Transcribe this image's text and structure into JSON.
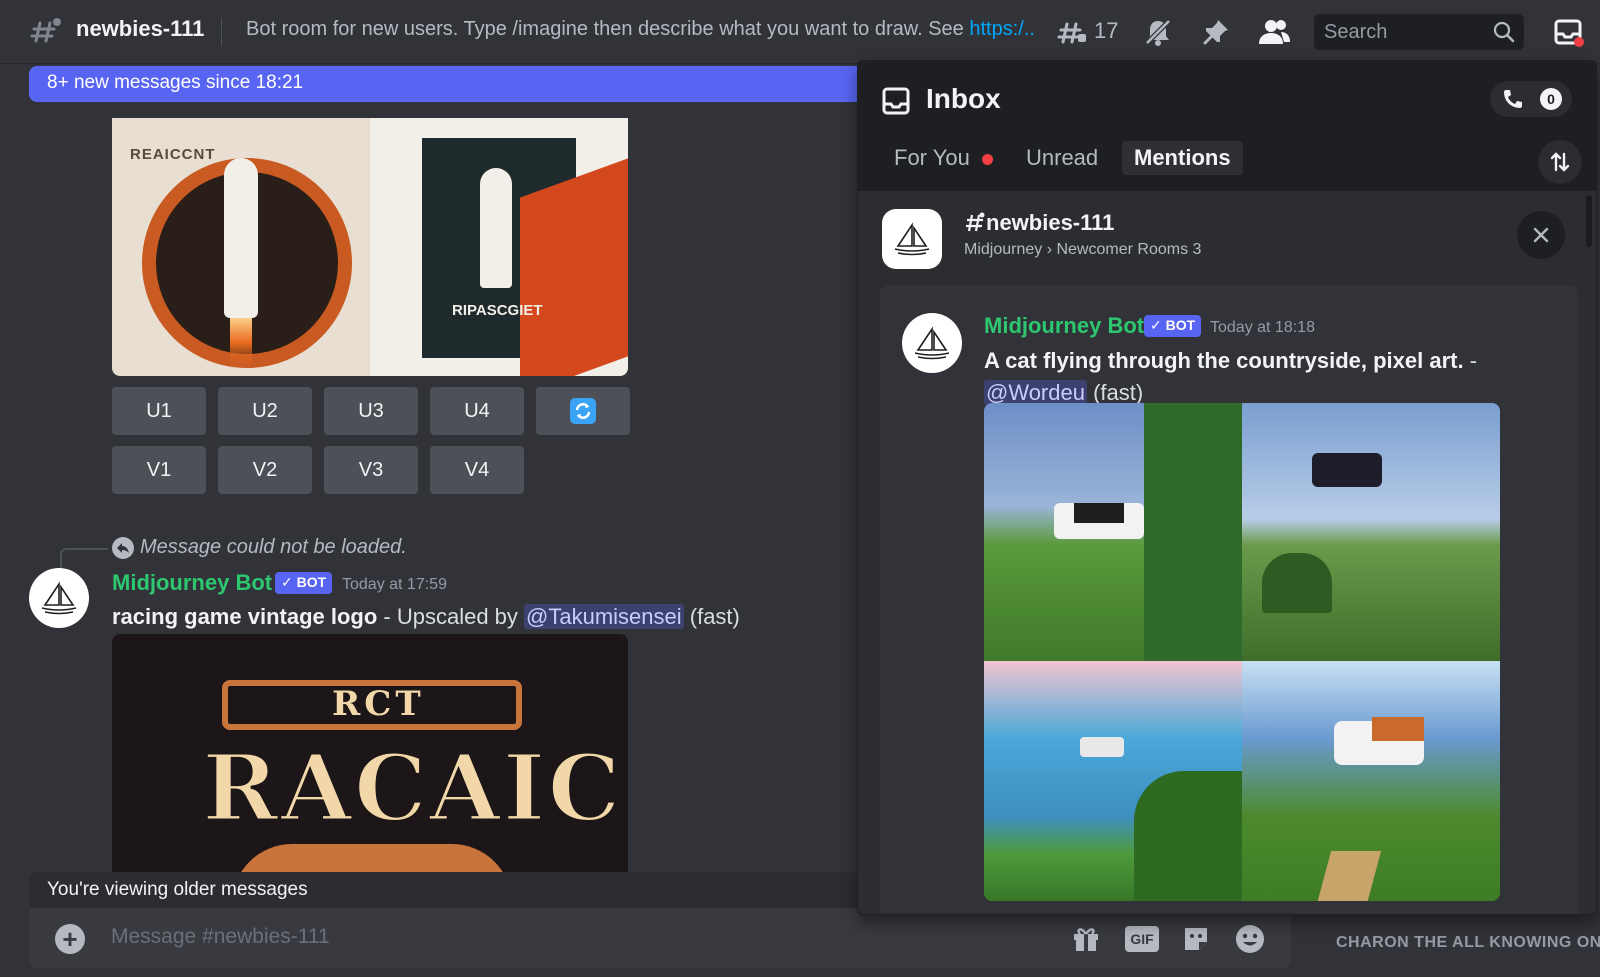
{
  "header": {
    "channel_name": "newbies-111",
    "topic": "Bot room for new users. Type /imagine then describe what you want to draw. See ",
    "topic_link": "https:/...",
    "thread_count": "17",
    "search_placeholder": "Search"
  },
  "chat": {
    "new_messages_banner": "8+ new messages since 18:21",
    "upscale_buttons": [
      "U1",
      "U2",
      "U3",
      "U4"
    ],
    "variation_buttons": [
      "V1",
      "V2",
      "V3",
      "V4"
    ],
    "rocket_titles": [
      "REAICCNT",
      "RIPASCGIET"
    ],
    "reply_notice": "Message could not be loaded.",
    "message": {
      "author": "Midjourney Bot",
      "bot_tag": "✓ BOT",
      "timestamp": "Today at 17:59",
      "prompt": "racing game vintage logo",
      "suffix": " - Upscaled by ",
      "mention": "@Takumisensei",
      "speed": " (fast)",
      "logo_top": "RCT",
      "logo_main": "RACAIC"
    },
    "older_notice": "You're viewing older messages",
    "composer_placeholder": "Message #newbies-111",
    "gif_label": "GIF"
  },
  "members": {
    "role_header": "CHARON THE ALL KNOWING ON"
  },
  "inbox": {
    "title": "Inbox",
    "unread_count": "0",
    "tabs": [
      "For You",
      "Unread",
      "Mentions"
    ],
    "active_tab": "Mentions",
    "channel": {
      "name": "newbies-111",
      "path": "Midjourney › Newcomer Rooms 3"
    },
    "message": {
      "author": "Midjourney Bot",
      "bot_tag": "✓ BOT",
      "timestamp": "Today at 18:18",
      "prompt": "A cat flying through the countryside, pixel art.",
      "dash": " -",
      "mention": "@Wordeu",
      "speed": " (fast)"
    }
  },
  "colors": {
    "blurple": "#5865f2",
    "bot_green": "#2dc770",
    "link": "#00a8fc",
    "notification_red": "#f23f43"
  }
}
